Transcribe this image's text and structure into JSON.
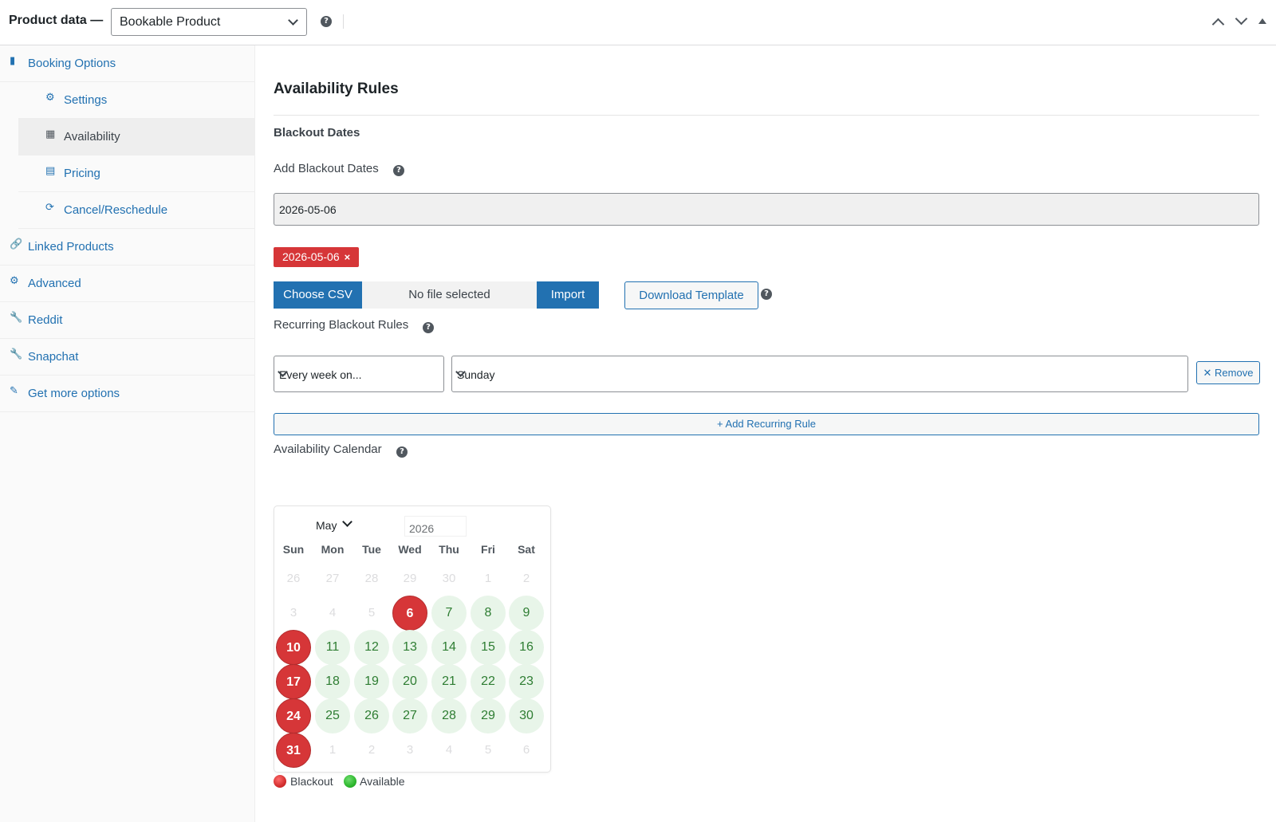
{
  "header": {
    "title": "Product data —",
    "product_type": "Bookable Product"
  },
  "sidebar": {
    "items": [
      {
        "label": "Booking Options",
        "icon": "book-icon"
      },
      {
        "label": "Settings",
        "icon": "gear-icon"
      },
      {
        "label": "Availability",
        "icon": "calendar-icon"
      },
      {
        "label": "Pricing",
        "icon": "list-icon"
      },
      {
        "label": "Cancel/Reschedule",
        "icon": "refresh-icon"
      },
      {
        "label": "Linked Products",
        "icon": "link-icon"
      },
      {
        "label": "Advanced",
        "icon": "gear-icon"
      },
      {
        "label": "Reddit",
        "icon": "wrench-icon"
      },
      {
        "label": "Snapchat",
        "icon": "wrench-icon"
      },
      {
        "label": "Get more options",
        "icon": "plugin-icon"
      }
    ]
  },
  "main": {
    "heading": "Availability Rules",
    "section": "Blackout Dates",
    "add_blackout_label": "Add Blackout Dates",
    "blackout_input_value": "2026-05-06",
    "tag": "2026-05-06",
    "tag_remove": "×",
    "choose_csv": "Choose CSV",
    "no_file": "No file selected",
    "import": "Import",
    "download_template": "Download Template",
    "recurring_label": "Recurring Blackout Rules",
    "recurring_frequency": "Every week on...",
    "recurring_day": "Sunday",
    "remove": "✕ Remove",
    "add_rule": "+ Add Recurring Rule",
    "calendar_label": "Availability Calendar"
  },
  "calendar": {
    "month": "May",
    "year": "2026",
    "weekdays": [
      "Sun",
      "Mon",
      "Tue",
      "Wed",
      "Thu",
      "Fri",
      "Sat"
    ],
    "weeks": [
      [
        [
          "26",
          "out"
        ],
        [
          "27",
          "out"
        ],
        [
          "28",
          "out"
        ],
        [
          "29",
          "out"
        ],
        [
          "30",
          "out"
        ],
        [
          "1",
          "out"
        ],
        [
          "2",
          "out"
        ]
      ],
      [
        [
          "3",
          "out"
        ],
        [
          "4",
          "out"
        ],
        [
          "5",
          "out"
        ],
        [
          "6",
          "black"
        ],
        [
          "7",
          "avail"
        ],
        [
          "8",
          "avail"
        ],
        [
          "9",
          "avail"
        ]
      ],
      [
        [
          "10",
          "black"
        ],
        [
          "11",
          "avail"
        ],
        [
          "12",
          "avail"
        ],
        [
          "13",
          "avail"
        ],
        [
          "14",
          "avail"
        ],
        [
          "15",
          "avail"
        ],
        [
          "16",
          "avail"
        ]
      ],
      [
        [
          "17",
          "black"
        ],
        [
          "18",
          "avail"
        ],
        [
          "19",
          "avail"
        ],
        [
          "20",
          "avail"
        ],
        [
          "21",
          "avail"
        ],
        [
          "22",
          "avail"
        ],
        [
          "23",
          "avail"
        ]
      ],
      [
        [
          "24",
          "black"
        ],
        [
          "25",
          "avail"
        ],
        [
          "26",
          "avail"
        ],
        [
          "27",
          "avail"
        ],
        [
          "28",
          "avail"
        ],
        [
          "29",
          "avail"
        ],
        [
          "30",
          "avail"
        ]
      ],
      [
        [
          "31",
          "black"
        ],
        [
          "1",
          "out"
        ],
        [
          "2",
          "out"
        ],
        [
          "3",
          "out"
        ],
        [
          "4",
          "out"
        ],
        [
          "5",
          "out"
        ],
        [
          "6",
          "out"
        ]
      ]
    ],
    "legend_blackout": "Blackout",
    "legend_available": "Available"
  },
  "colors": {
    "accent": "#2271b1",
    "blackout": "#d63638",
    "available_bg": "#e8f5e9",
    "available_text": "#2e7d32"
  }
}
